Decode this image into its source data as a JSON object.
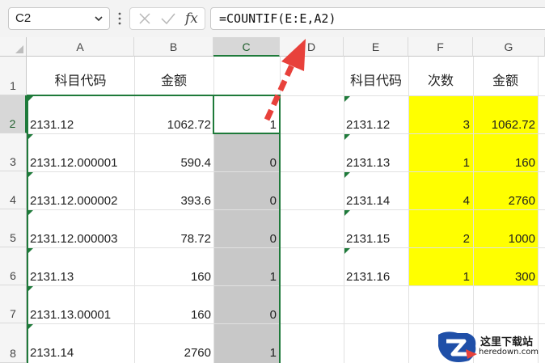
{
  "formula_bar": {
    "name_box": "C2",
    "formula": "=COUNTIF(E:E,A2)",
    "fx_label": "fx"
  },
  "columns": [
    "A",
    "B",
    "C",
    "D",
    "E",
    "F",
    "G"
  ],
  "selected_column": "C",
  "rows": [
    "1",
    "2",
    "3",
    "4",
    "5",
    "6",
    "7",
    "8"
  ],
  "selected_row": "2",
  "left_table": {
    "headers": [
      "科目代码",
      "金额",
      ""
    ],
    "rows": [
      {
        "code": "2131.12",
        "amount": "1062.72",
        "count": "1"
      },
      {
        "code": "2131.12.000001",
        "amount": "590.4",
        "count": "0"
      },
      {
        "code": "2131.12.000002",
        "amount": "393.6",
        "count": "0"
      },
      {
        "code": "2131.12.000003",
        "amount": "78.72",
        "count": "0"
      },
      {
        "code": "2131.13",
        "amount": "160",
        "count": "1"
      },
      {
        "code": "2131.13.00001",
        "amount": "160",
        "count": "0"
      },
      {
        "code": "2131.14",
        "amount": "2760",
        "count": "1"
      }
    ]
  },
  "right_table": {
    "headers": [
      "科目代码",
      "次数",
      "金额"
    ],
    "rows": [
      {
        "code": "2131.12",
        "times": "3",
        "amount": "1062.72"
      },
      {
        "code": "2131.13",
        "times": "1",
        "amount": "160"
      },
      {
        "code": "2131.14",
        "times": "4",
        "amount": "2760"
      },
      {
        "code": "2131.15",
        "times": "2",
        "amount": "1000"
      },
      {
        "code": "2131.16",
        "times": "1",
        "amount": "300"
      }
    ]
  },
  "watermark": {
    "title": "这里下载站",
    "subtitle": "heredown.com"
  },
  "colors": {
    "highlight": "#ffff00",
    "selection": "#1e7a3a",
    "arrow": "#e8413b",
    "grey_fill": "#c8c8c8"
  }
}
